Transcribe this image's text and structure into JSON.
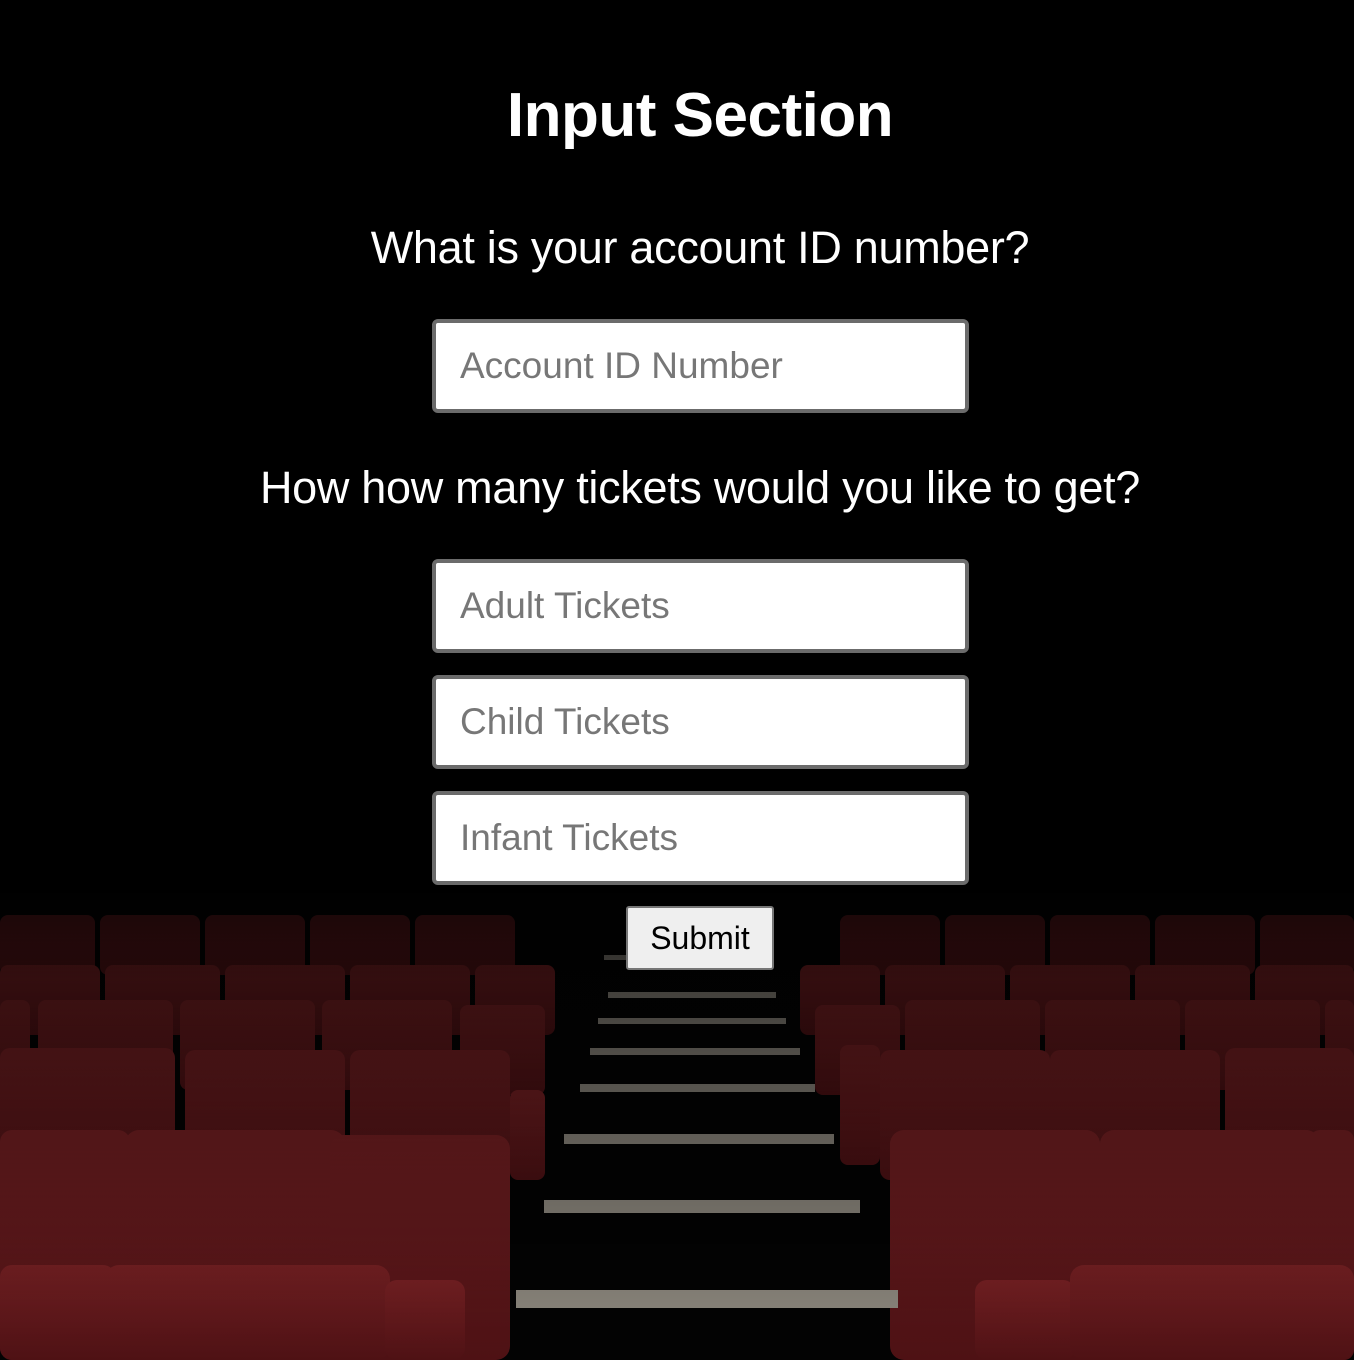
{
  "page": {
    "heading": "Input Section",
    "background_image": "theater-seats-stairs"
  },
  "account_section": {
    "question": "What is your account ID number?",
    "account_id": {
      "value": "",
      "placeholder": "Account ID Number"
    }
  },
  "tickets_section": {
    "question": "How how many tickets would you like to get?",
    "adult": {
      "value": "",
      "placeholder": "Adult Tickets"
    },
    "child": {
      "value": "",
      "placeholder": "Child Tickets"
    },
    "infant": {
      "value": "",
      "placeholder": "Infant Tickets"
    }
  },
  "submit": {
    "label": "Submit"
  },
  "colors": {
    "background": "#000000",
    "seat_red": "#6e1a1c",
    "text": "#ffffff",
    "input_border": "#6b6b6b"
  }
}
